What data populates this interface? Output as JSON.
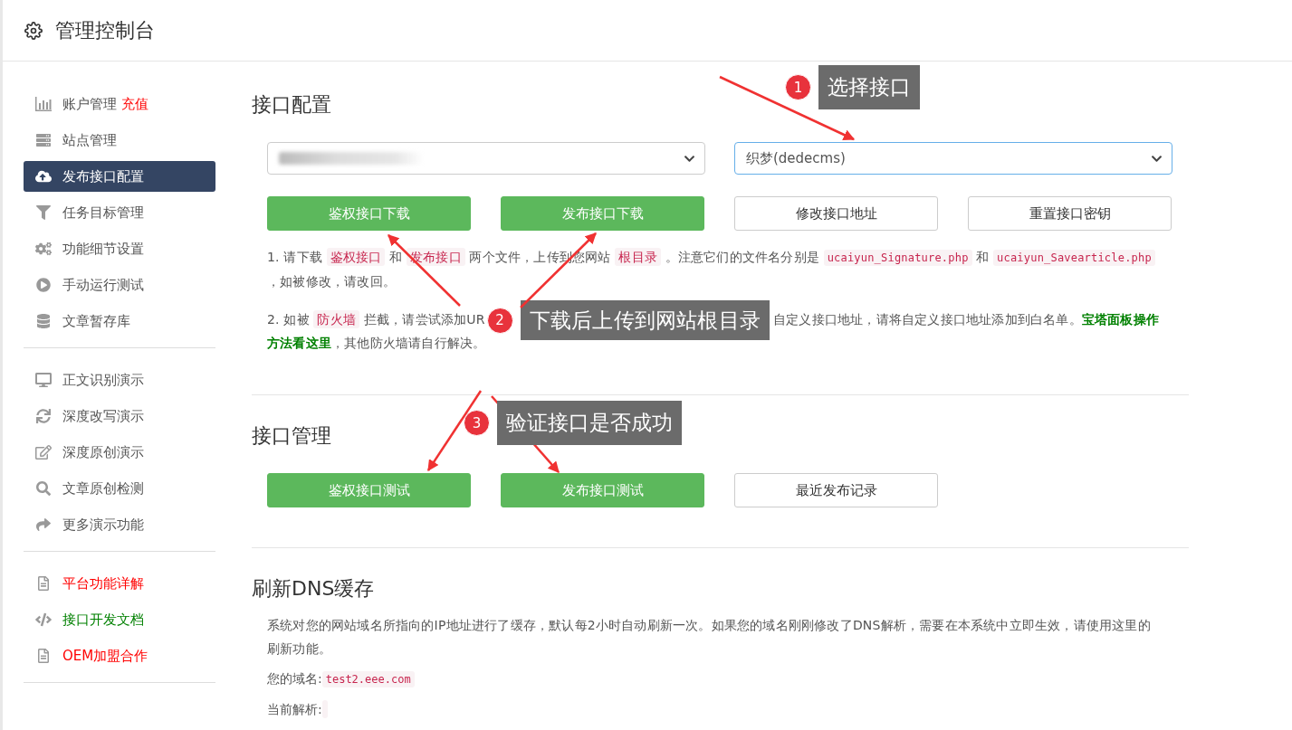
{
  "header": {
    "title": "管理控制台"
  },
  "sidebar": {
    "groups": [
      {
        "items": [
          {
            "label": "账户管理",
            "extra": "充值",
            "selected": false
          },
          {
            "label": "站点管理",
            "selected": false
          },
          {
            "label": "发布接口配置",
            "selected": true
          },
          {
            "label": "任务目标管理",
            "selected": false
          },
          {
            "label": "功能细节设置",
            "selected": false
          },
          {
            "label": "手动运行测试",
            "selected": false
          },
          {
            "label": "文章暂存库",
            "selected": false
          }
        ]
      },
      {
        "items": [
          {
            "label": "正文识别演示",
            "selected": false
          },
          {
            "label": "深度改写演示",
            "selected": false
          },
          {
            "label": "深度原创演示",
            "selected": false
          },
          {
            "label": "文章原创检测",
            "selected": false
          },
          {
            "label": "更多演示功能",
            "selected": false
          }
        ]
      },
      {
        "items": [
          {
            "label": "平台功能详解",
            "color": "#ff0000",
            "selected": false
          },
          {
            "label": "接口开发文档",
            "color": "#008000",
            "selected": false
          },
          {
            "label": "OEM加盟合作",
            "color": "#ff0000",
            "selected": false
          }
        ]
      }
    ]
  },
  "config": {
    "title": "接口配置",
    "selects": [
      {
        "kind": "blurred",
        "focused": false
      },
      {
        "kind": "text",
        "value": "织梦(dedecms)",
        "focused": true
      }
    ],
    "buttons": [
      {
        "label": "鉴权接口下载",
        "kind": "primary"
      },
      {
        "label": "发布接口下载",
        "kind": "primary"
      },
      {
        "label": "修改接口地址",
        "kind": "default"
      },
      {
        "label": "重置接口密钥",
        "kind": "default"
      }
    ],
    "note_1": [
      {
        "kind": "text",
        "text": "1. 请下载 "
      },
      {
        "kind": "code",
        "text": "鉴权接口"
      },
      {
        "kind": "text",
        "text": " 和 "
      },
      {
        "kind": "code",
        "text": "发布接口"
      },
      {
        "kind": "text",
        "text": " 两个文件，上传到您网站 "
      },
      {
        "kind": "code",
        "text": "根目录"
      },
      {
        "kind": "text",
        "text": " 。注意它们的文件名分别是 "
      },
      {
        "kind": "mono",
        "text": "ucaiyun_Signature.php"
      },
      {
        "kind": "text",
        "text": " 和 "
      },
      {
        "kind": "mono",
        "text": "ucaiyun_Savearticle.php"
      },
      {
        "kind": "text",
        "text": " ，如被修改，请改回。"
      }
    ],
    "note_2": {
      "before": [
        {
          "kind": "text",
          "text": "2. 如被 "
        },
        {
          "kind": "code",
          "text": "防火墙"
        },
        {
          "kind": "text",
          "text": " 拦截，请尝试添加UR"
        }
      ],
      "after": [
        {
          "kind": "text",
          "text": "自定义接口地址，请将自定义接口地址添加到白名单。"
        },
        {
          "kind": "link",
          "text": "宝塔面板操作方法看这里"
        },
        {
          "kind": "text",
          "text": "，其他防火墙请自行解决。"
        }
      ]
    }
  },
  "management": {
    "title": "接口管理",
    "buttons": [
      {
        "label": "鉴权接口测试",
        "kind": "primary"
      },
      {
        "label": "发布接口测试",
        "kind": "primary"
      },
      {
        "label": "最近发布记录",
        "kind": "default"
      }
    ]
  },
  "dns": {
    "title": "刷新DNS缓存",
    "description": "系统对您的网站域名所指向的IP地址进行了缓存，默认每2小时自动刷新一次。如果您的域名刚刚修改了DNS解析，需要在本系统中立即生效，请使用这里的刷新功能。",
    "domain_label": "您的域名:",
    "domain": "test2.eee.com",
    "resolve_label": "当前解析:"
  },
  "callouts": [
    {
      "number": "1",
      "text": "选择接口"
    },
    {
      "number": "2",
      "text": "下载后上传到网站根目录"
    },
    {
      "number": "3",
      "text": "验证接口是否成功"
    }
  ]
}
